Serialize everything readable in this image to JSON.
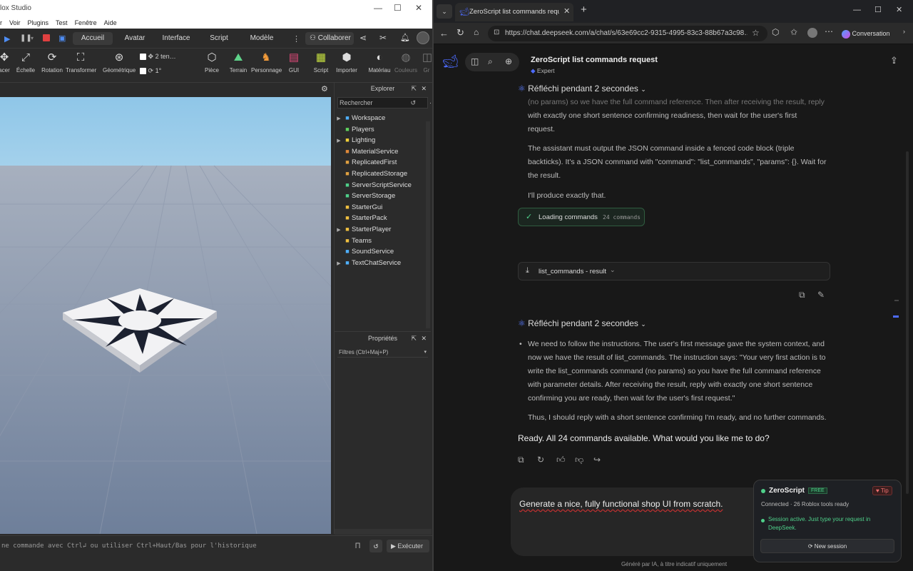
{
  "studio": {
    "title": "lox Studio",
    "menu": [
      "r",
      "Voir",
      "Plugins",
      "Test",
      "Fenêtre",
      "Aide"
    ],
    "tabs": [
      "Accueil",
      "Avatar",
      "Interface",
      "Script",
      "Modèle"
    ],
    "collab_label": "Collaborer",
    "ribbon": [
      {
        "label": "acer",
        "icon": "move-icon"
      },
      {
        "label": "Échelle",
        "icon": "scale-icon"
      },
      {
        "label": "Rotation",
        "icon": "rotate-icon"
      },
      {
        "label": "Transformer",
        "icon": "transform-icon"
      },
      {
        "label": "Géométrique",
        "icon": "geometric-icon"
      },
      {
        "label": "Pièce",
        "icon": "part-icon"
      },
      {
        "label": "Terrain",
        "icon": "terrain-icon"
      },
      {
        "label": "Personnage",
        "icon": "character-icon"
      },
      {
        "label": "GUI",
        "icon": "gui-icon"
      },
      {
        "label": "Script",
        "icon": "script-icon"
      },
      {
        "label": "Importer",
        "icon": "import-icon"
      },
      {
        "label": "Matériau",
        "icon": "material-icon"
      },
      {
        "label": "Couleurs",
        "icon": "colors-icon"
      },
      {
        "label": "Gr",
        "icon": "group-icon"
      }
    ],
    "snap_move": "2 ten…",
    "snap_rotate": "1°",
    "explorer": {
      "title": "Explorer",
      "search_placeholder": "Rechercher",
      "items": [
        {
          "label": "Workspace",
          "expandable": true,
          "color": "#4fb0ff"
        },
        {
          "label": "Players",
          "expandable": false,
          "color": "#5fd35f"
        },
        {
          "label": "Lighting",
          "expandable": true,
          "color": "#f2d13a"
        },
        {
          "label": "MaterialService",
          "expandable": false,
          "color": "#e08a3a"
        },
        {
          "label": "ReplicatedFirst",
          "expandable": false,
          "color": "#e0a040"
        },
        {
          "label": "ReplicatedStorage",
          "expandable": false,
          "color": "#e0a040"
        },
        {
          "label": "ServerScriptService",
          "expandable": false,
          "color": "#4fd08a"
        },
        {
          "label": "ServerStorage",
          "expandable": false,
          "color": "#4fd08a"
        },
        {
          "label": "StarterGui",
          "expandable": false,
          "color": "#f0c040"
        },
        {
          "label": "StarterPack",
          "expandable": false,
          "color": "#f0c040"
        },
        {
          "label": "StarterPlayer",
          "expandable": true,
          "color": "#f0c040"
        },
        {
          "label": "Teams",
          "expandable": false,
          "color": "#f0c040"
        },
        {
          "label": "SoundService",
          "expandable": false,
          "color": "#4fb0ff"
        },
        {
          "label": "TextChatService",
          "expandable": true,
          "color": "#4fb0ff"
        }
      ]
    },
    "properties": {
      "title": "Propriétés",
      "filter_placeholder": "Filtres (Ctrl+Maj+P)"
    },
    "command_placeholder": "ne commande avec Ctrl↲ ou utiliser Ctrl+Haut/Bas pour l'historique",
    "execute_label": "Exécuter"
  },
  "browser": {
    "tab_title": "ZeroScript list commands request",
    "url": "https://chat.deepseek.com/a/chat/s/63e69cc2-9315-4995-83c3-88b67a3c98…",
    "conversation_label": "Conversation"
  },
  "chat": {
    "title": "ZeroScript list commands request",
    "subtitle": "Expert",
    "think_label": "Réfléchi pendant 2 secondes",
    "block1": [
      "(no params) so we have the full command reference. Then after receiving the result, reply",
      "with exactly one short sentence confirming readiness, then wait for the user's first",
      "request."
    ],
    "block2": [
      "The assistant must output the JSON command inside a fenced code block (triple",
      "backticks). It's a JSON command with \"command\": \"list_commands\", \"params\": {}. Wait for",
      "the result."
    ],
    "block3": "I'll produce exactly that.",
    "loading_label": "Loading commands",
    "loading_count": "24 commands",
    "result_label": "list_commands - result",
    "think2_label": "Réfléchi pendant 2 secondes",
    "block4": [
      "We need to follow the instructions. The user's first message gave the system context, and",
      "now we have the result of list_commands. The instruction says: \"Your very first action is to",
      "write the list_commands command (no params) so you have the full command reference",
      "with parameter details. After receiving the result, reply with exactly one short sentence",
      "confirming you are ready, then wait for the user's first request.\""
    ],
    "block5": "Thus, I should reply with a short sentence confirming I'm ready, and no further commands.",
    "answer": "Ready. All 24 commands available. What would you like me to do?",
    "input_value": "Generate a nice, fully functional shop UI from scratch.",
    "footer": "Généré par IA, à titre indicatif uniquement"
  },
  "zeroscript": {
    "name": "ZeroScript",
    "badge": "FREE",
    "tip": "♥ Tip",
    "status": "Connected · 26 Roblox tools ready",
    "session": "Session active. Just type your request in DeepSeek.",
    "new_session": "⟳ New session"
  }
}
